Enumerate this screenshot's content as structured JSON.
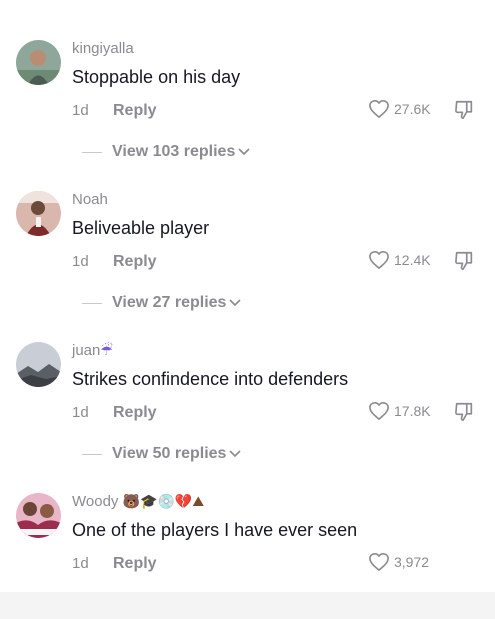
{
  "comments": [
    {
      "username": "kingiyalla",
      "emojis": "",
      "text": "Stoppable on his day",
      "age": "1d",
      "reply": "Reply",
      "likes": "27.6K",
      "view_replies": "View 103 replies",
      "avatar_colors": [
        "#8fa79a",
        "#4d5c52"
      ]
    },
    {
      "username": "Noah",
      "emojis": "",
      "text": "Beliveable player",
      "age": "1d",
      "reply": "Reply",
      "likes": "12.4K",
      "view_replies": "View 27 replies",
      "avatar_colors": [
        "#d9b7ad",
        "#7d2b2a"
      ]
    },
    {
      "username": "juan",
      "emojis": "☔",
      "text": "Strikes confindence into defenders",
      "age": "1d",
      "reply": "Reply",
      "likes": "17.8K",
      "view_replies": "View 50 replies",
      "avatar_colors": [
        "#c9ced6",
        "#5a5f66"
      ]
    },
    {
      "username": "Woody",
      "emojis": "🐻🎓💿💔⛰",
      "text": "One of the players I have ever seen",
      "age": "1d",
      "reply": "Reply",
      "likes": "3,972",
      "avatar_colors": [
        "#e8b6c6",
        "#9b2d4f"
      ]
    }
  ],
  "colors": {
    "primary_text": "#161823",
    "secondary_text": "#8a8b91"
  },
  "icons": {
    "like": "heart-outline-icon",
    "dislike": "thumbs-down-icon",
    "expand": "chevron-down-icon"
  }
}
